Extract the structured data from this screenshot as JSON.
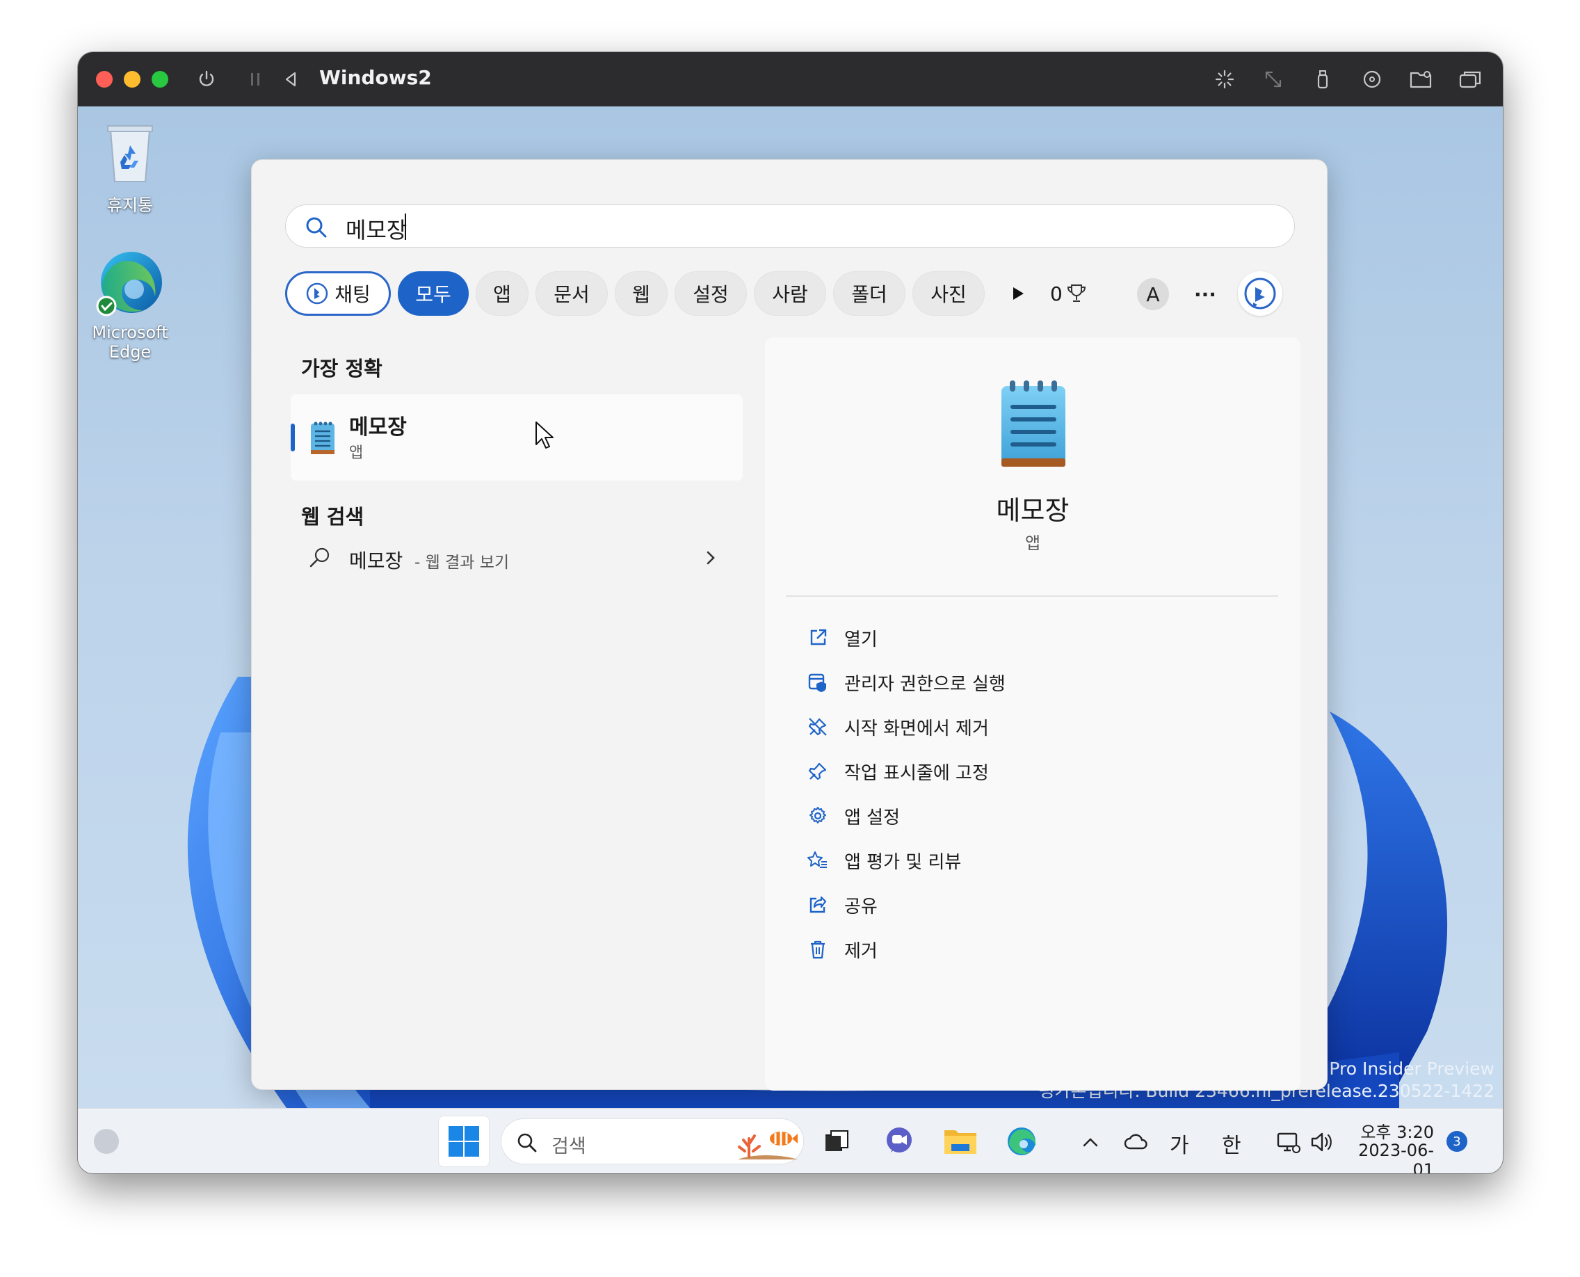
{
  "window": {
    "title": "Windows2",
    "traffic_lights": [
      "#ff5f57",
      "#febc2e",
      "#28c840"
    ],
    "toolbar_icons": [
      "power-icon",
      "pause-icon",
      "back-icon",
      "brightness-icon",
      "resize-icon",
      "usb-icon",
      "disc-icon",
      "folder-icon",
      "windows-icon"
    ]
  },
  "desktop": {
    "icons": [
      {
        "label": "휴지통",
        "icon": "recycle-bin-icon"
      },
      {
        "label_line1": "Microsoft",
        "label_line2": "Edge",
        "icon": "edge-icon"
      }
    ],
    "watermark_line1": "11 Pro Insider Preview",
    "watermark_line2": "평가본입니다. Build 23466.ni_prerelease.230522-1422"
  },
  "start_search": {
    "query": "메모장",
    "chips": [
      {
        "label": "채팅",
        "state": "chat"
      },
      {
        "label": "모두",
        "state": "active"
      },
      {
        "label": "앱"
      },
      {
        "label": "문서"
      },
      {
        "label": "웹"
      },
      {
        "label": "설정"
      },
      {
        "label": "사람"
      },
      {
        "label": "폴더"
      },
      {
        "label": "사진"
      }
    ],
    "reward_points": "0",
    "avatar_letter": "A",
    "more_label": "···",
    "best_match": {
      "section_title": "가장 정확",
      "name": "메모장",
      "type": "앱"
    },
    "web_search": {
      "section_title": "웹 검색",
      "query": "메모장",
      "suffix": " - 웹 결과 보기"
    },
    "preview": {
      "name": "메모장",
      "type": "앱",
      "actions": [
        {
          "label": "열기",
          "icon": "open-external-icon"
        },
        {
          "label": "관리자 권한으로 실행",
          "icon": "admin-shield-icon"
        },
        {
          "label": "시작 화면에서 제거",
          "icon": "unpin-icon"
        },
        {
          "label": "작업 표시줄에 고정",
          "icon": "pin-icon"
        },
        {
          "label": "앱 설정",
          "icon": "gear-icon"
        },
        {
          "label": "앱 평가 및 리뷰",
          "icon": "star-review-icon"
        },
        {
          "label": "공유",
          "icon": "share-icon"
        },
        {
          "label": "제거",
          "icon": "trash-icon"
        }
      ]
    }
  },
  "taskbar": {
    "search_placeholder": "검색",
    "ime_ga": "가",
    "ime_han": "한",
    "time": "오후 3:20",
    "date": "2023-06-01",
    "notification_count": "3",
    "accent": "#1e63c8"
  }
}
